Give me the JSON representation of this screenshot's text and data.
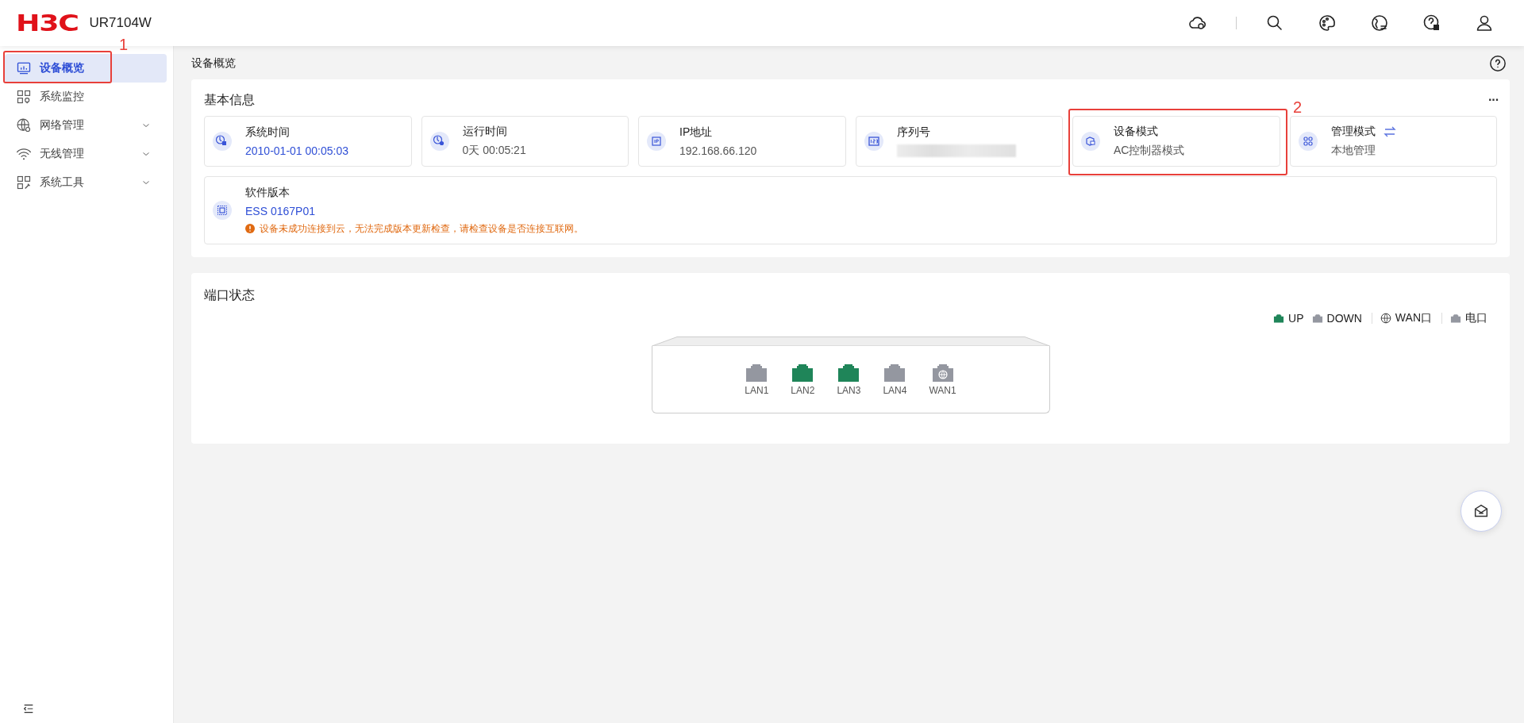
{
  "header": {
    "logo": "H3C",
    "model": "UR7104W"
  },
  "sidebar": {
    "items": [
      {
        "label": "设备概览",
        "selected": true,
        "expandable": false
      },
      {
        "label": "系统监控",
        "selected": false,
        "expandable": false
      },
      {
        "label": "网络管理",
        "selected": false,
        "expandable": true
      },
      {
        "label": "无线管理",
        "selected": false,
        "expandable": true
      },
      {
        "label": "系统工具",
        "selected": false,
        "expandable": true
      }
    ]
  },
  "breadcrumb": "设备概览",
  "basic_info": {
    "title": "基本信息",
    "more": "···",
    "cards": [
      {
        "label": "系统时间",
        "value": "2010-01-01 00:05:03",
        "link": true
      },
      {
        "label": "运行时间",
        "value": "0天 00:05:21",
        "link": false
      },
      {
        "label": "IP地址",
        "value": "192.168.66.120",
        "link": false
      },
      {
        "label": "序列号",
        "redacted": true
      },
      {
        "label": "设备模式",
        "value": "AC控制器模式",
        "link": false
      },
      {
        "label": "管理模式",
        "value": "本地管理",
        "link": false,
        "switchable": true
      }
    ],
    "software": {
      "label": "软件版本",
      "value": "ESS 0167P01",
      "warning": "设备未成功连接到云，无法完成版本更新检查，请检查设备是否连接互联网。"
    }
  },
  "port_status": {
    "title": "端口状态",
    "legend": [
      {
        "kind": "up",
        "label": "UP"
      },
      {
        "kind": "down",
        "label": "DOWN"
      },
      {
        "kind": "wan",
        "label": "WAN口"
      },
      {
        "kind": "eth",
        "label": "电口"
      }
    ],
    "ports": [
      {
        "label": "LAN1",
        "kind": "lan",
        "up": false
      },
      {
        "label": "LAN2",
        "kind": "lan",
        "up": true
      },
      {
        "label": "LAN3",
        "kind": "lan",
        "up": true
      },
      {
        "label": "LAN4",
        "kind": "lan",
        "up": false
      },
      {
        "label": "WAN1",
        "kind": "wan",
        "up": false
      }
    ]
  },
  "annotations": [
    {
      "label": "1"
    },
    {
      "label": "2"
    }
  ]
}
